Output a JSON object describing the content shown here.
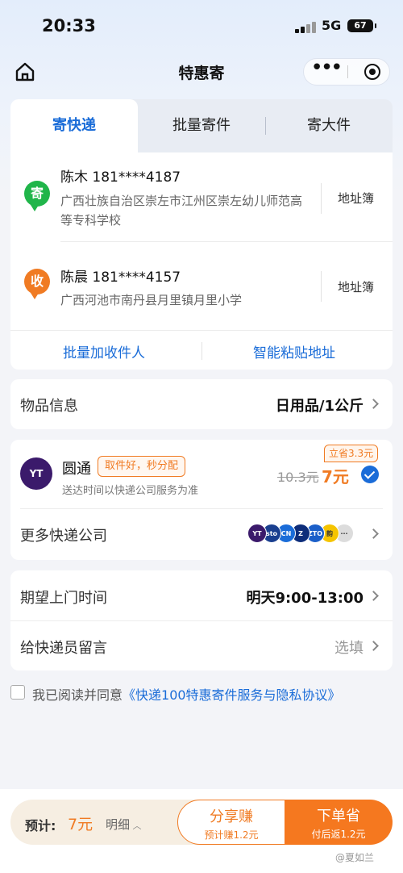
{
  "status_bar": {
    "time": "20:33",
    "network": "5G",
    "battery": "67"
  },
  "nav": {
    "title": "特惠寄",
    "more_icon": "more-dots-icon",
    "close_icon": "target-circle-icon"
  },
  "tabs": [
    {
      "label": "寄快递",
      "active": true
    },
    {
      "label": "批量寄件",
      "active": false
    },
    {
      "label": "寄大件",
      "active": false
    }
  ],
  "sender": {
    "badge": "寄",
    "name_phone": "陈木 181****4187",
    "address": "广西壮族自治区崇左市江州区崇左幼儿师范高等专科学校",
    "book": "地址簿"
  },
  "receiver": {
    "badge": "收",
    "name_phone": "陈晨 181****4157",
    "address": "广西河池市南丹县月里镇月里小学",
    "book": "地址簿"
  },
  "actions": {
    "batch": "批量加收件人",
    "paste": "智能粘贴地址"
  },
  "goods": {
    "label": "物品信息",
    "value": "日用品/1公斤"
  },
  "courier": {
    "logo_text": "YT",
    "name": "圆通",
    "tag": "取件好，秒分配",
    "sub": "送达时间以快递公司服务为准",
    "save_tag": "立省3.3元",
    "old_price": "10.3元",
    "new_price": "7元",
    "more_label": "更多快递公司",
    "logos": [
      {
        "text": "YT",
        "color": "#3b1a6b"
      },
      {
        "text": "sto",
        "color": "#1a3f8f"
      },
      {
        "text": "CN",
        "color": "#1a6cd8"
      },
      {
        "text": "Z",
        "color": "#0d2d7a"
      },
      {
        "text": "ZTO",
        "color": "#1b5fc9"
      },
      {
        "text": "韵",
        "color": "#f5c400"
      },
      {
        "text": "···",
        "color": "#dcdcdc"
      }
    ]
  },
  "pickup": {
    "label": "期望上门时间",
    "value": "明天9:00-13:00"
  },
  "note": {
    "label": "给快递员留言",
    "value": "选填"
  },
  "agree": {
    "prefix": "我已阅读并同意",
    "link": "《快递100特惠寄件服务与隐私协议》"
  },
  "footer": {
    "estimate_label": "预计:",
    "estimate_price": "7元",
    "detail": "明细",
    "share_main": "分享赚",
    "share_sub": "预计赚1.2元",
    "order_main": "下单省",
    "order_sub": "付后返1.2元",
    "watermark": "@夏如兰"
  },
  "colors": {
    "accent": "#1a6cd8",
    "orange": "#f07b23",
    "green": "#20b54a"
  }
}
